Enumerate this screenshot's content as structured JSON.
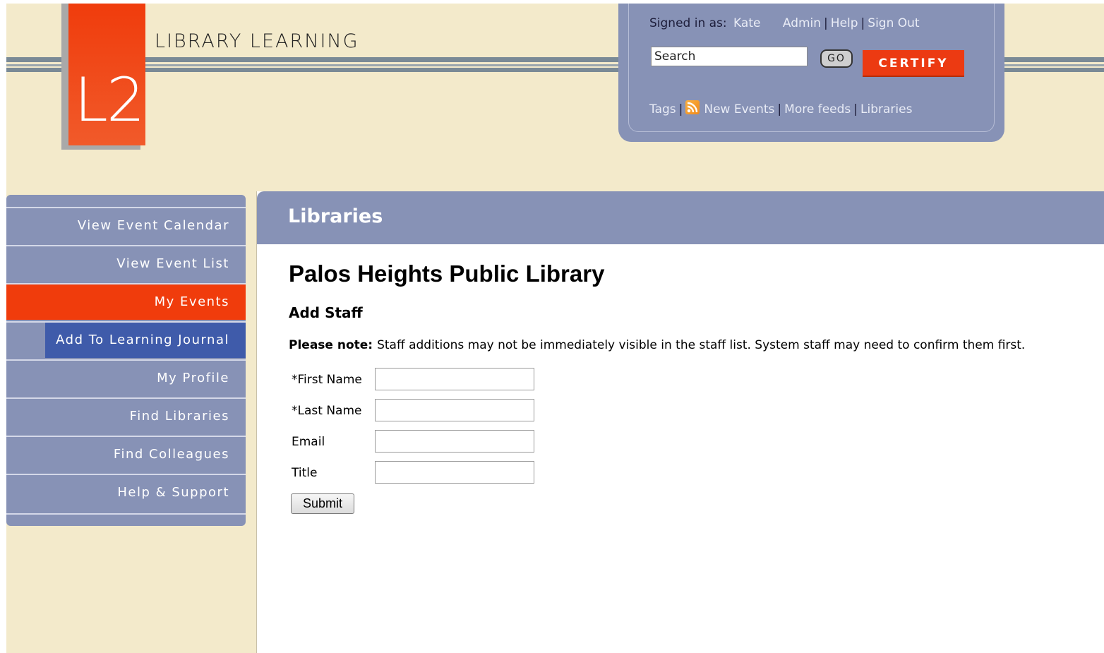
{
  "brand": {
    "logo_text": "L2",
    "name": "LIBRARY LEARNING"
  },
  "user_panel": {
    "signed_in_label": "Signed in as:",
    "user_name": "Kate",
    "links": [
      "Admin",
      "Help",
      "Sign Out"
    ],
    "search_placeholder": "Search",
    "go_label": "GO",
    "certify_label": "CERTIFY",
    "feed_links": [
      "Tags",
      "New Events",
      "More feeds",
      "Libraries"
    ]
  },
  "sidebar": {
    "items": [
      {
        "label": "View Event Calendar",
        "state": "normal"
      },
      {
        "label": "View Event List",
        "state": "normal"
      },
      {
        "label": "My Events",
        "state": "active"
      },
      {
        "label": "Add To Learning Journal",
        "state": "hover"
      },
      {
        "label": "My Profile",
        "state": "normal"
      },
      {
        "label": "Find Libraries",
        "state": "normal"
      },
      {
        "label": "Find Colleagues",
        "state": "normal"
      },
      {
        "label": "Help & Support",
        "state": "normal"
      }
    ]
  },
  "main": {
    "section_title": "Libraries",
    "library_name": "Palos Heights Public Library",
    "form_title": "Add Staff",
    "note_label": "Please note:",
    "note_text": "Staff additions may not be immediately visible in the staff list. System staff may need to confirm them first.",
    "fields": [
      {
        "label": "*First Name",
        "value": ""
      },
      {
        "label": "*Last Name",
        "value": ""
      },
      {
        "label": "Email",
        "value": ""
      },
      {
        "label": "Title",
        "value": ""
      }
    ],
    "submit_label": "Submit"
  },
  "colors": {
    "header_bg": "#f3eacb",
    "panel_blue": "#8792b6",
    "accent_orange": "#f03c0c",
    "hover_blue": "#3f5baa"
  }
}
